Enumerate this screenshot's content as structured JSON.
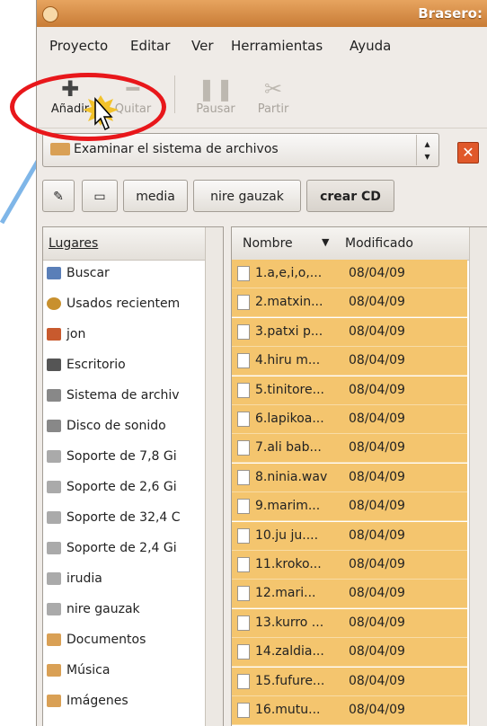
{
  "window": {
    "title": "Brasero:"
  },
  "menubar": [
    "Proyecto",
    "Editar",
    "Ver",
    "Herramientas",
    "Ayuda"
  ],
  "toolbar": {
    "add": "Añadir",
    "remove": "Quitar",
    "pause": "Pausar",
    "split": "Partir"
  },
  "location": {
    "value": "Examinar el sistema de archivos"
  },
  "pathbar": [
    "media",
    "nire gauzak",
    "crear CD"
  ],
  "sidebar": {
    "header": "Lugares",
    "items": [
      {
        "label": "Buscar",
        "icon": "search-icon"
      },
      {
        "label": "Usados recientem",
        "icon": "recent-icon"
      },
      {
        "label": "jon",
        "icon": "home-icon"
      },
      {
        "label": "Escritorio",
        "icon": "desktop-icon"
      },
      {
        "label": "Sistema de archiv",
        "icon": "filesystem-icon"
      },
      {
        "label": "Disco de sonido",
        "icon": "disc-icon"
      },
      {
        "label": "Soporte de 7,8 Gi",
        "icon": "drive-icon"
      },
      {
        "label": "Soporte de 2,6 Gi",
        "icon": "drive-icon"
      },
      {
        "label": "Soporte de 32,4 C",
        "icon": "drive-icon"
      },
      {
        "label": "Soporte de 2,4 Gi",
        "icon": "drive-icon"
      },
      {
        "label": "irudia",
        "icon": "drive-icon"
      },
      {
        "label": "nire gauzak",
        "icon": "drive-icon"
      },
      {
        "label": "Documentos",
        "icon": "folder-icon"
      },
      {
        "label": "Música",
        "icon": "folder-icon"
      },
      {
        "label": "Imágenes",
        "icon": "folder-icon"
      }
    ]
  },
  "filelist": {
    "col_name": "Nombre",
    "col_modified": "Modificado",
    "rows": [
      {
        "name": "1.a,e,i,o,...",
        "date": "08/04/09"
      },
      {
        "name": "2.matxin...",
        "date": "08/04/09"
      },
      {
        "name": "3.patxi p...",
        "date": "08/04/09"
      },
      {
        "name": "4.hiru m...",
        "date": "08/04/09"
      },
      {
        "name": "5.tinitore...",
        "date": "08/04/09"
      },
      {
        "name": "6.lapikoa...",
        "date": "08/04/09"
      },
      {
        "name": "7.ali bab...",
        "date": "08/04/09"
      },
      {
        "name": "8.ninia.wav",
        "date": "08/04/09"
      },
      {
        "name": "9.marim...",
        "date": "08/04/09"
      },
      {
        "name": "10.ju ju....",
        "date": "08/04/09"
      },
      {
        "name": "11.kroko...",
        "date": "08/04/09"
      },
      {
        "name": "12.mari...",
        "date": "08/04/09"
      },
      {
        "name": "13.kurro ...",
        "date": "08/04/09"
      },
      {
        "name": "14.zaldia...",
        "date": "08/04/09"
      },
      {
        "name": "15.fufure...",
        "date": "08/04/09"
      },
      {
        "name": "16.mutu...",
        "date": "08/04/09"
      }
    ]
  },
  "colors": {
    "highlight_circle": "#e8171b",
    "arrow": "#7fb6e8",
    "selection": "#f4c56e",
    "titlebar": "#d58a42"
  }
}
